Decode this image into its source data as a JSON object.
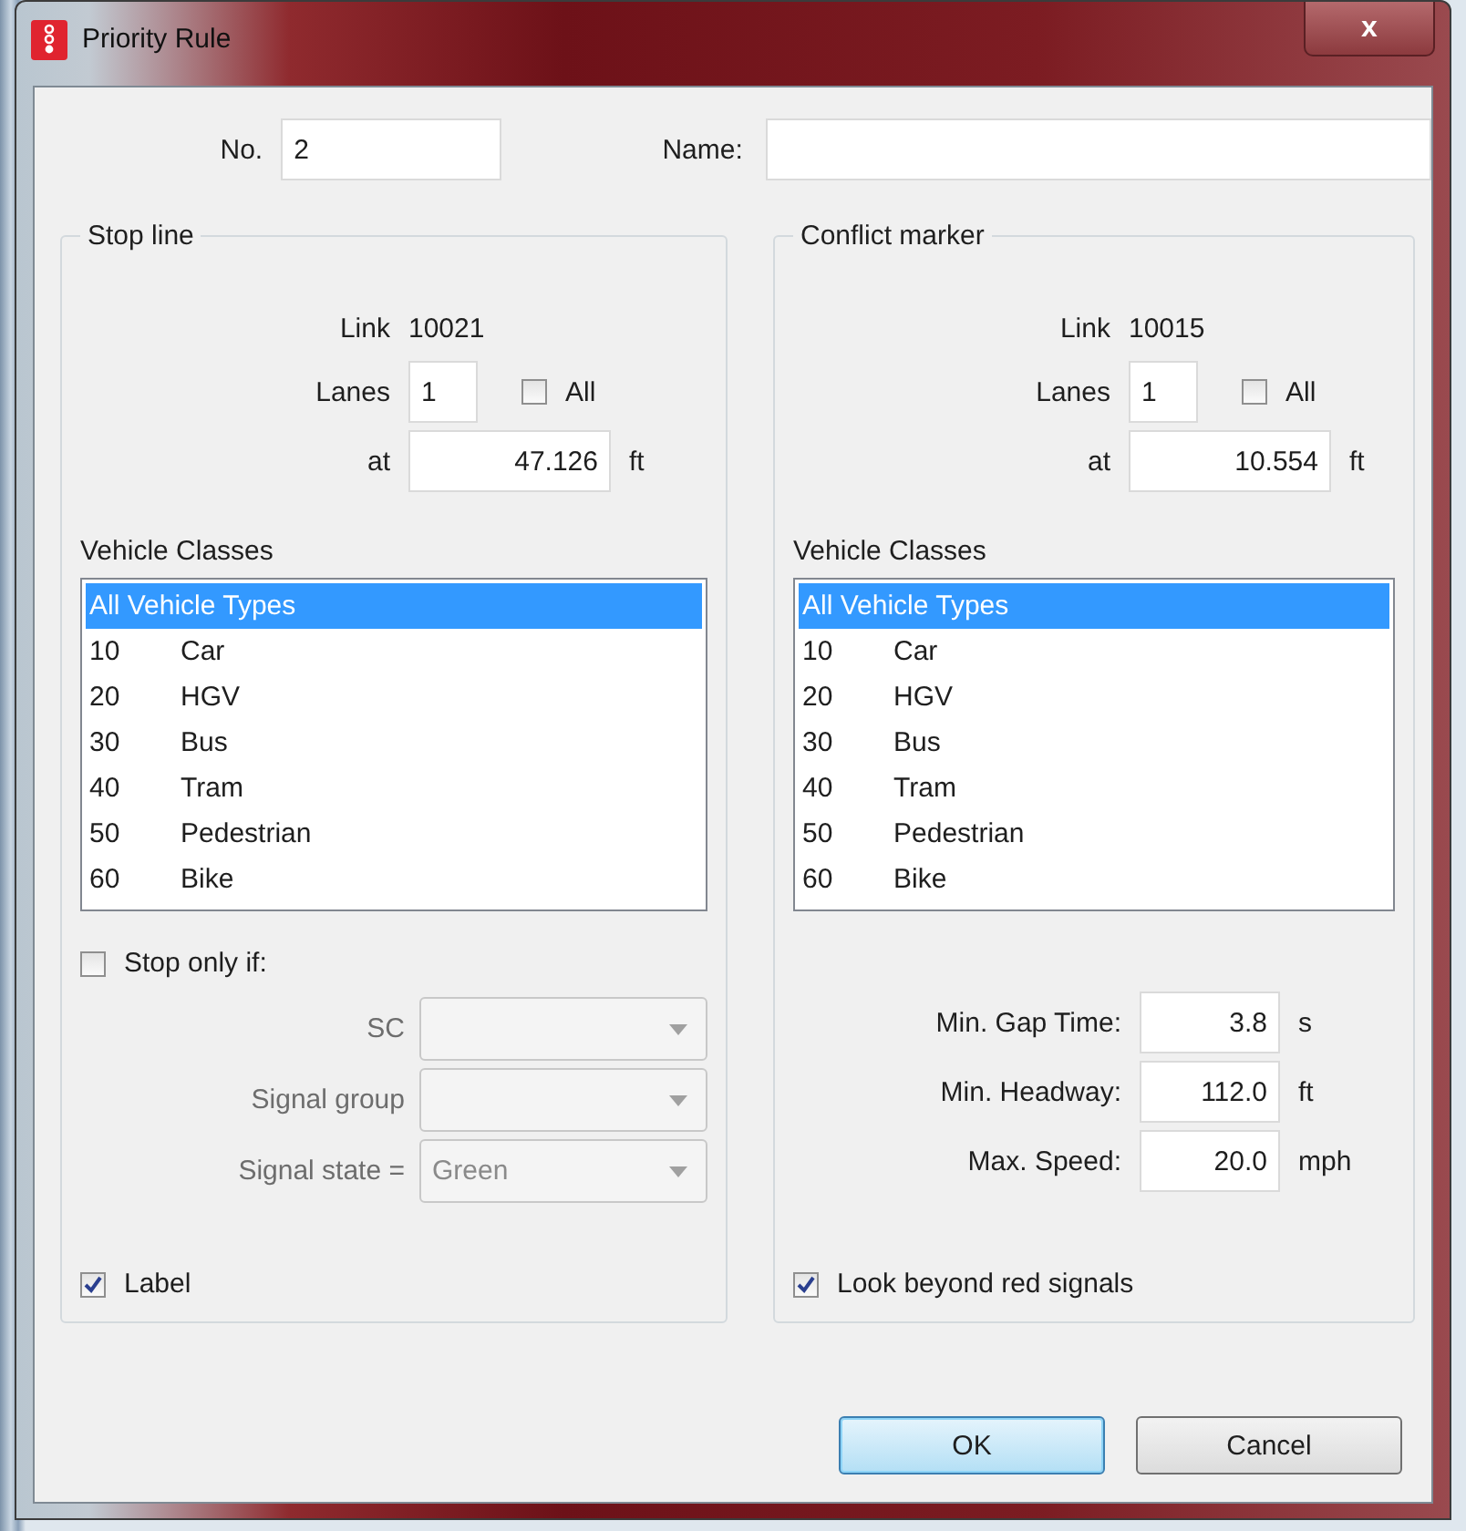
{
  "window": {
    "title": "Priority Rule",
    "close": "x"
  },
  "number": {
    "label": "No.",
    "value": "2"
  },
  "name": {
    "label": "Name:"
  },
  "groups": [
    {
      "kind": "stop",
      "title": "Stop line",
      "link_label": "Link",
      "link_value": "10021",
      "lanes_label": "Lanes",
      "lanes_value": "1",
      "all": {
        "label": "All",
        "checked": false
      },
      "at_label": "at",
      "at_value": "47.126",
      "at_unit": "ft",
      "classes_label": "Vehicle Classes",
      "classes": [
        {
          "name": "All Vehicle Types",
          "selected": true
        },
        {
          "code": "10",
          "name": "Car",
          "selected": false
        },
        {
          "code": "20",
          "name": "HGV",
          "selected": false
        },
        {
          "code": "30",
          "name": "Bus",
          "selected": false
        },
        {
          "code": "40",
          "name": "Tram",
          "selected": false
        },
        {
          "code": "50",
          "name": "Pedestrian",
          "selected": false
        },
        {
          "code": "60",
          "name": "Bike",
          "selected": false
        }
      ],
      "condition": {
        "label": "Stop only if:",
        "checked": false
      },
      "combos": [
        {
          "label": "SC",
          "disabled": true
        },
        {
          "label": "Signal group",
          "disabled": true
        },
        {
          "label": "Signal state =",
          "value": "Green",
          "disabled": true
        }
      ],
      "option": {
        "label": "Label",
        "checked": true
      }
    },
    {
      "kind": "conflict",
      "title": "Conflict marker",
      "link_label": "Link",
      "link_value": "10015",
      "lanes_label": "Lanes",
      "lanes_value": "1",
      "all": {
        "label": "All",
        "checked": false
      },
      "at_label": "at",
      "at_value": "10.554",
      "at_unit": "ft",
      "classes_label": "Vehicle Classes",
      "classes": [
        {
          "name": "All Vehicle Types",
          "selected": true
        },
        {
          "code": "10",
          "name": "Car",
          "selected": false
        },
        {
          "code": "20",
          "name": "HGV",
          "selected": false
        },
        {
          "code": "30",
          "name": "Bus",
          "selected": false
        },
        {
          "code": "40",
          "name": "Tram",
          "selected": false
        },
        {
          "code": "50",
          "name": "Pedestrian",
          "selected": false
        },
        {
          "code": "60",
          "name": "Bike",
          "selected": false
        }
      ],
      "params": [
        {
          "label": "Min. Gap Time:",
          "value": "3.8",
          "unit": "s"
        },
        {
          "label": "Min. Headway:",
          "value": "112.0",
          "unit": "ft"
        },
        {
          "label": "Max. Speed:",
          "value": "20.0",
          "unit": "mph"
        }
      ],
      "option": {
        "label": "Look beyond red signals",
        "checked": true
      }
    }
  ],
  "buttons": [
    {
      "label": "OK",
      "default": true
    },
    {
      "label": "Cancel",
      "default": false
    }
  ]
}
